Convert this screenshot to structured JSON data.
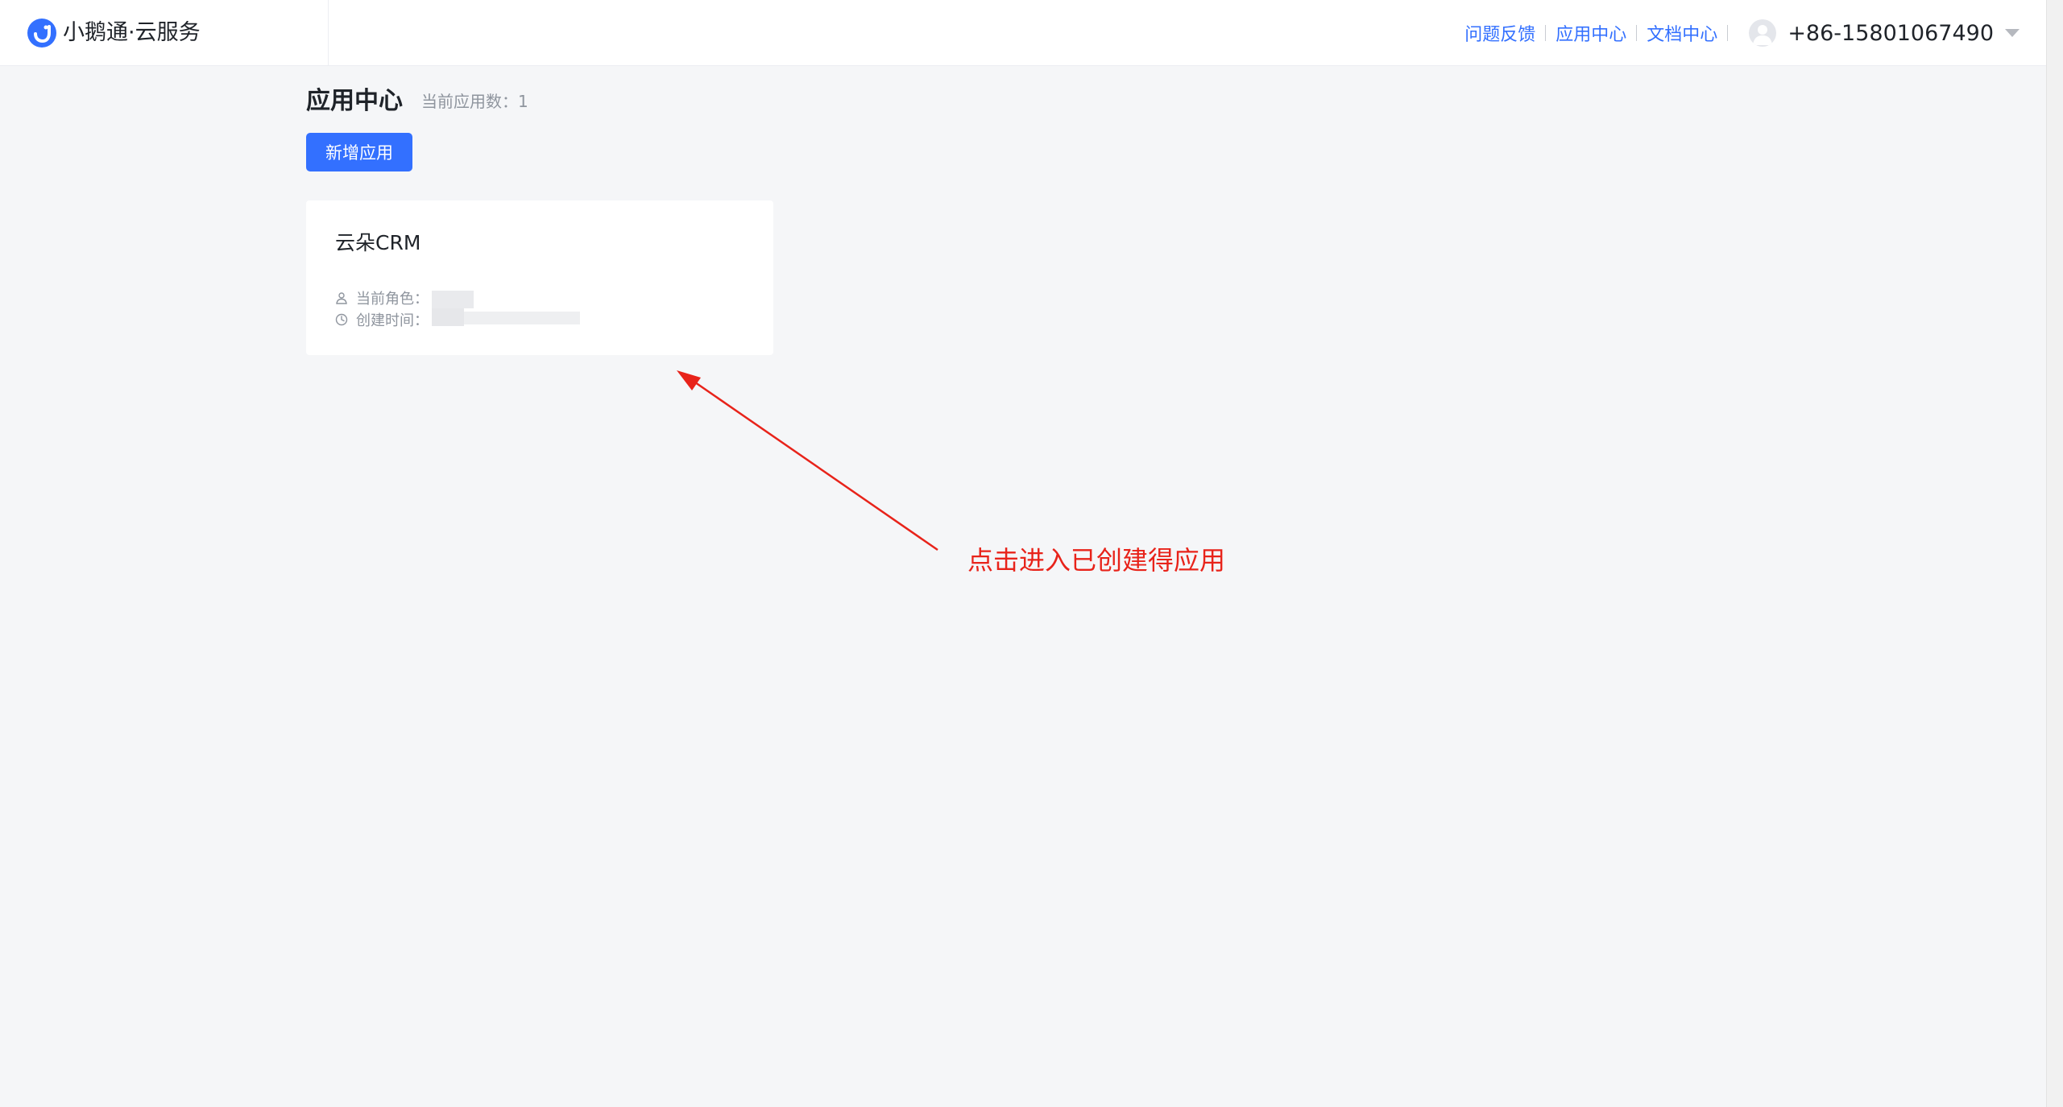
{
  "header": {
    "brand": "小鹅通·云服务",
    "nav": {
      "feedback": "问题反馈",
      "app_center": "应用中心",
      "docs": "文档中心"
    },
    "phone": "+86-15801067490"
  },
  "main": {
    "title": "应用中心",
    "app_count_label": "当前应用数：1",
    "add_button_label": "新增应用",
    "apps": [
      {
        "name": "云朵CRM",
        "role_label": "当前角色：",
        "created_label": "创建时间："
      }
    ]
  },
  "annotation": {
    "text": "点击进入已创建得应用",
    "color": "#e8231a"
  },
  "colors": {
    "accent": "#3370ff",
    "background": "#f5f6f8"
  }
}
